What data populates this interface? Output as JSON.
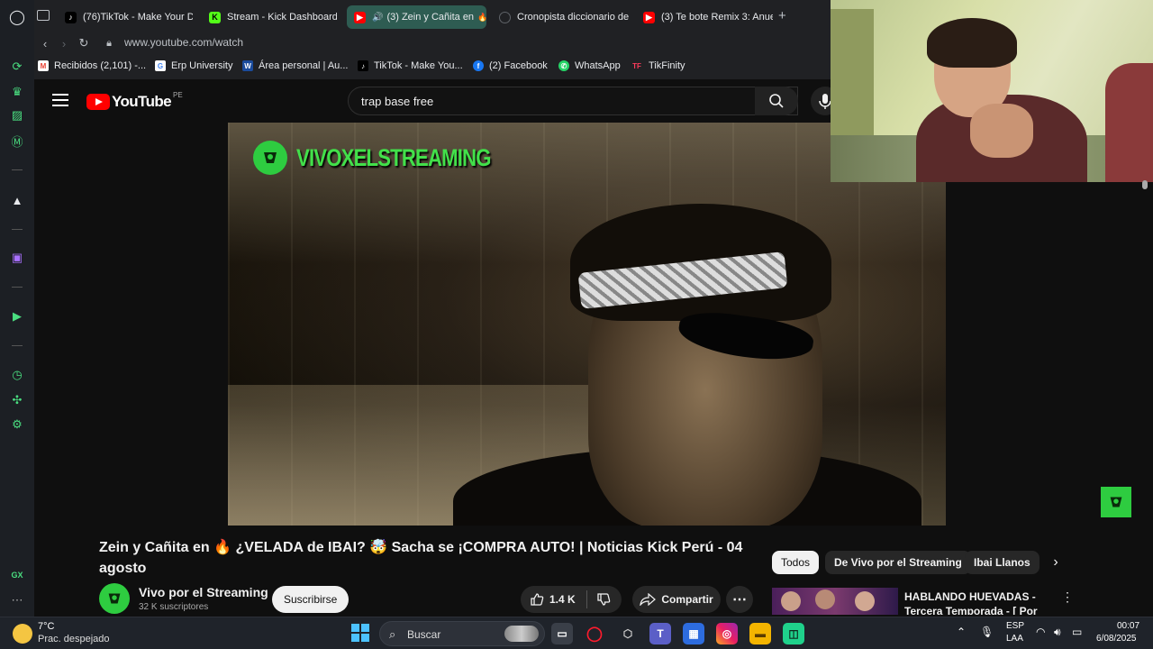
{
  "browser": {
    "tabs": [
      {
        "label": "(76)TikTok - Make Your D",
        "icon": "tiktok-icon",
        "color": "#000000"
      },
      {
        "label": "Stream - Kick Dashboard",
        "icon": "kick-icon",
        "color": "#53fc18"
      },
      {
        "label": "(3) Zein y Cañita en",
        "icon": "youtube-icon",
        "color": "#ff0000"
      },
      {
        "label": "Cronopista diccionario de",
        "icon": "loading-icon",
        "color": "#5f6368"
      },
      {
        "label": "(3) Te bote Remix 3: Anue",
        "icon": "youtube-icon",
        "color": "#ff0000"
      }
    ],
    "new_tab": "+",
    "url": "www.youtube.com/watch",
    "bookmarks": [
      {
        "label": "Recibidos (2,101) -...",
        "icon": "gmail-icon",
        "glyph": "M"
      },
      {
        "label": "Erp University",
        "icon": "google-icon",
        "glyph": "G"
      },
      {
        "label": "Área personal | Au...",
        "icon": "shield-icon",
        "glyph": "W"
      },
      {
        "label": "TikTok - Make You...",
        "icon": "tiktok-icon",
        "glyph": "♪"
      },
      {
        "label": "(2) Facebook",
        "icon": "facebook-icon",
        "glyph": "f"
      },
      {
        "label": "WhatsApp",
        "icon": "whatsapp-icon",
        "glyph": "✆"
      },
      {
        "label": "TikFinity",
        "icon": "tikfinity-icon",
        "glyph": "TF"
      }
    ]
  },
  "youtube": {
    "logo_text": "YouTube",
    "country": "PE",
    "search_value": "trap base free",
    "video_overlay_channel": "VIVOXELSTREAMING",
    "title": "Zein y Cañita en 🔥 ¿VELADA de IBAI? 🤯 Sacha se ¡COMPRA AUTO! | Noticias Kick Perú - 04 agosto",
    "channel_name": "Vivo por el Streaming",
    "subscribers": "32 K suscriptores",
    "subscribe_label": "Suscribirse",
    "likes": "1.4 K",
    "share_label": "Compartir",
    "more_label": "⋯",
    "chips": [
      "Todos",
      "De Vivo por el Streaming",
      "Ibai Llanos"
    ],
    "rec_title": "HABLANDO HUEVADAS - Tercera Temporada - [ Por qu",
    "rec_menu": "⋮"
  },
  "sidebar": {
    "gx_label": "GX",
    "more_label": "⋯"
  },
  "taskbar": {
    "temp": "7°C",
    "weather": "Prac. despejado",
    "search_label": "Buscar",
    "lang1": "ESP",
    "lang2": "LAA",
    "time": "00:07",
    "date": "6/08/2025"
  },
  "colors": {
    "accent": "#4ade80",
    "yt_red": "#ff0000",
    "channel_green": "#2ecc40"
  }
}
